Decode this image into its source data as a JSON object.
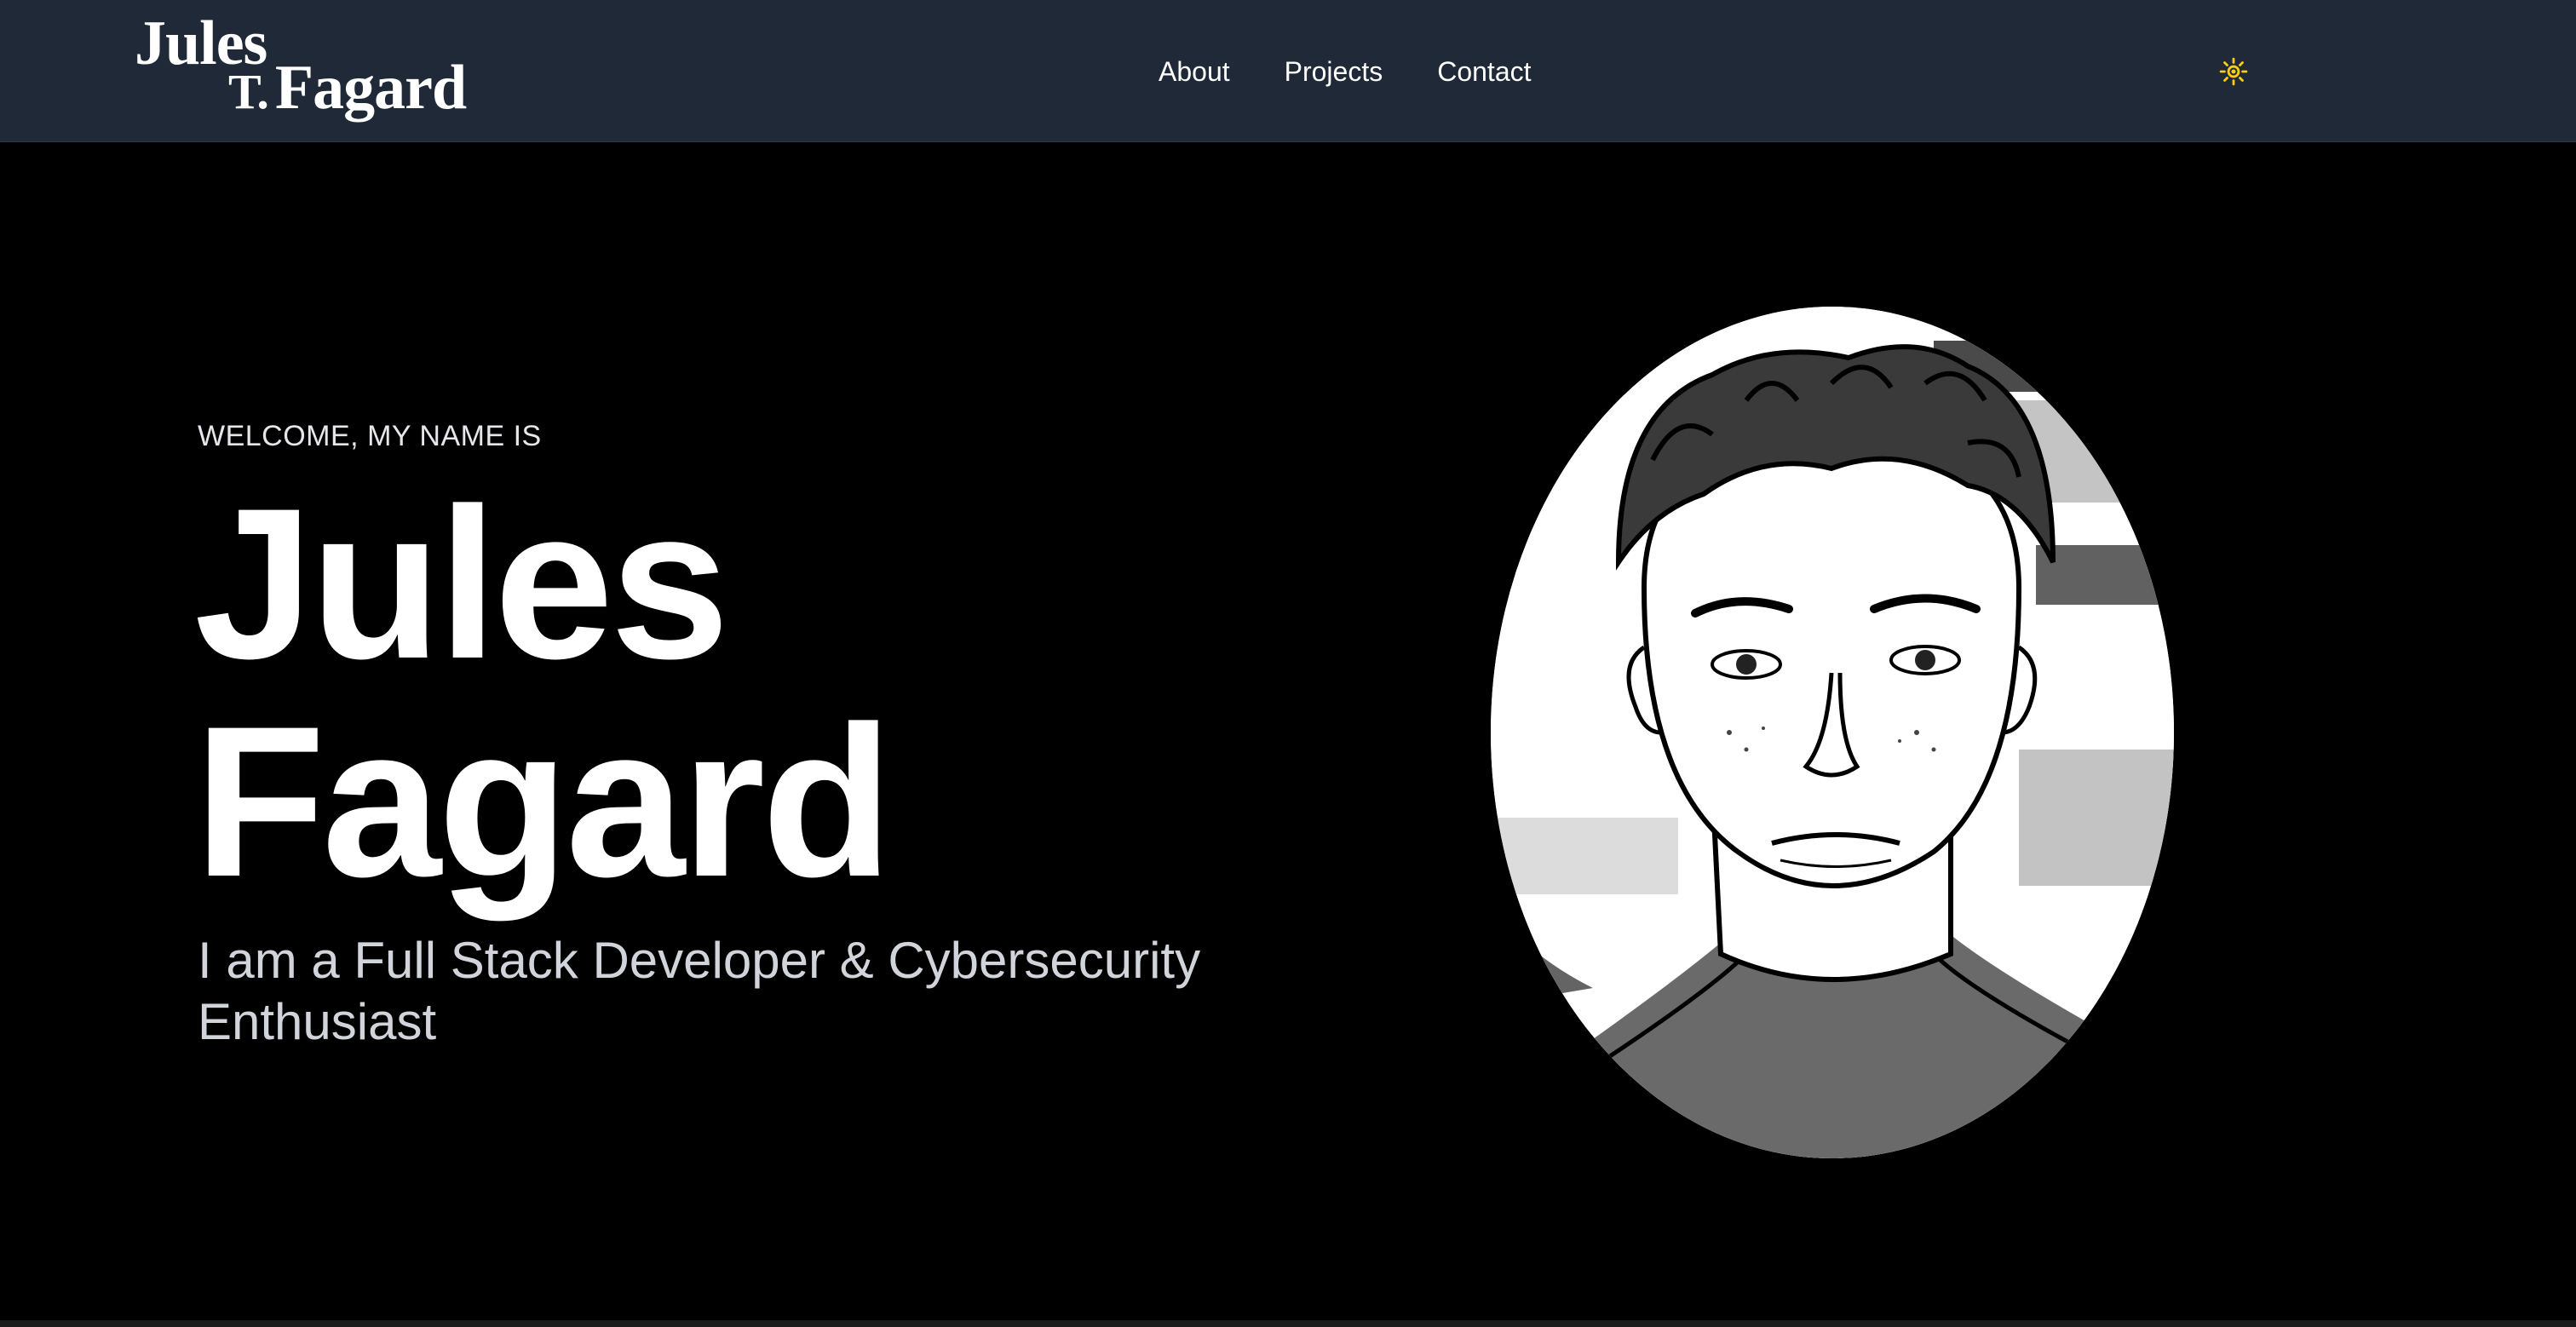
{
  "header": {
    "logo": {
      "line1": "Jules",
      "line2_initial": "T.",
      "line2_name": "Fagard"
    },
    "nav": [
      {
        "label": "About"
      },
      {
        "label": "Projects"
      },
      {
        "label": "Contact"
      }
    ],
    "theme_toggle_icon": "sun-icon",
    "theme_toggle_color": "#facc15"
  },
  "hero": {
    "welcome": "WELCOME, MY NAME IS",
    "first_name": "Jules",
    "last_name": "Fagard",
    "tagline": "I am a Full Stack Developer & Cybersecurity Enthusiast"
  },
  "colors": {
    "header_bg": "#1f2937",
    "page_bg": "#000000",
    "text_primary": "#ffffff",
    "text_secondary": "#d1d5db"
  }
}
